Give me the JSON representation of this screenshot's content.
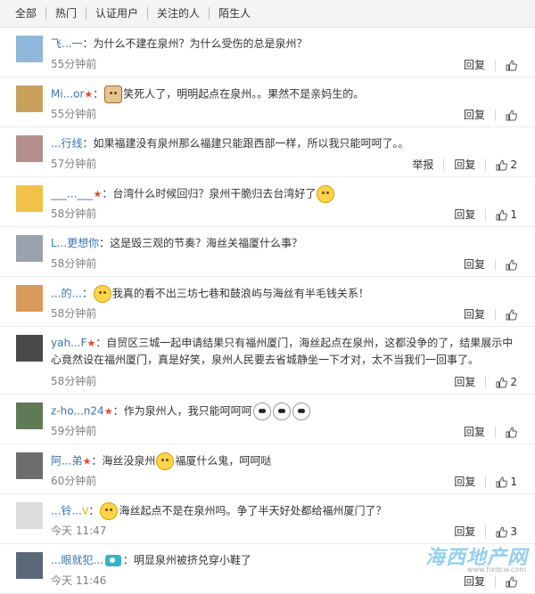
{
  "filters": [
    "全部",
    "热门",
    "认证用户",
    "关注的人",
    "陌生人"
  ],
  "reply_label": "回复",
  "report_label": "举报",
  "comments": [
    {
      "user": "飞...一",
      "text": "：为什么不建在泉州？为什么受伤的总是泉州？",
      "time": "55分钟前",
      "likes": "",
      "avatar_color": "#8fb7d9"
    },
    {
      "user": "Mi...or",
      "badge": "★",
      "text_pre": "：",
      "emoji": "doggy",
      "text": "笑死人了，明明起点在泉州。。果然不是亲妈生的。",
      "time": "55分钟前",
      "likes": "",
      "avatar_color": "#c7a15c"
    },
    {
      "user": "...行线",
      "text": "：如果福建没有泉州那么福建只能跟西部一样，所以我只能呵呵了。。",
      "time": "57分钟前",
      "likes": "2",
      "avatar_color": "#b58f8b"
    },
    {
      "user": "___...___",
      "badge": "★",
      "text": "：台湾什么时候回归？泉州干脆归去台湾好了",
      "emoji_after": "normal",
      "time": "58分钟前",
      "likes": "1",
      "avatar_color": "#f1c24a"
    },
    {
      "user": "L...更想你",
      "text": "：这是毁三观的节奏？海丝关福厦什么事？",
      "time": "58分钟前",
      "likes": "",
      "avatar_color": "#9aa3ad"
    },
    {
      "user": "...的...",
      "text_pre": "：",
      "emoji": "normal",
      "text": "我真的看不出三坊七巷和鼓浪屿与海丝有半毛钱关系！",
      "time": "58分钟前",
      "likes": "",
      "avatar_color": "#d99b5c"
    },
    {
      "user": "yah...F",
      "badge": "★",
      "text": "：自贸区三城一起申请结果只有福州厦门，海丝起点在泉州，这都没争的了，结果展示中心竟然设在福州厦门，真是好笑，泉州人民要去省城静坐一下才对，太不当我们一回事了。",
      "time": "58分钟前",
      "likes": "2",
      "avatar_color": "#4a4a4a",
      "tall": true
    },
    {
      "user": "z-ho...n24",
      "badge": "★",
      "text": "：作为泉州人，我只能呵呵呵",
      "emoji_after": "panda3",
      "time": "59分钟前",
      "likes": "",
      "avatar_color": "#5f7a55"
    },
    {
      "user": "阿...弟",
      "badge": "★",
      "text_pre": "：海丝没泉州",
      "emoji": "normal",
      "text": "福厦什么鬼，呵呵哒",
      "time": "60分钟前",
      "likes": "1",
      "avatar_color": "#6d6d6d"
    },
    {
      "user": "...铃...",
      "badge": "V",
      "badge_vip": true,
      "text_pre": "：",
      "emoji": "normal",
      "text": "海丝起点不是在泉州吗。争了半天好处都给福州厦门了？",
      "time": "今天 11:47",
      "likes": "3",
      "avatar_color": "#dcdcdc"
    },
    {
      "user": "...眼就犯...",
      "cam": true,
      "text": "：明显泉州被挤兑穿小鞋了",
      "time": "今天 11:46",
      "likes": "",
      "avatar_color": "#5a6878"
    }
  ],
  "watermark": "海西地产网",
  "watermark_sub": "www.hxdcw.com",
  "icons": {
    "like": "thumbs-up-icon"
  }
}
